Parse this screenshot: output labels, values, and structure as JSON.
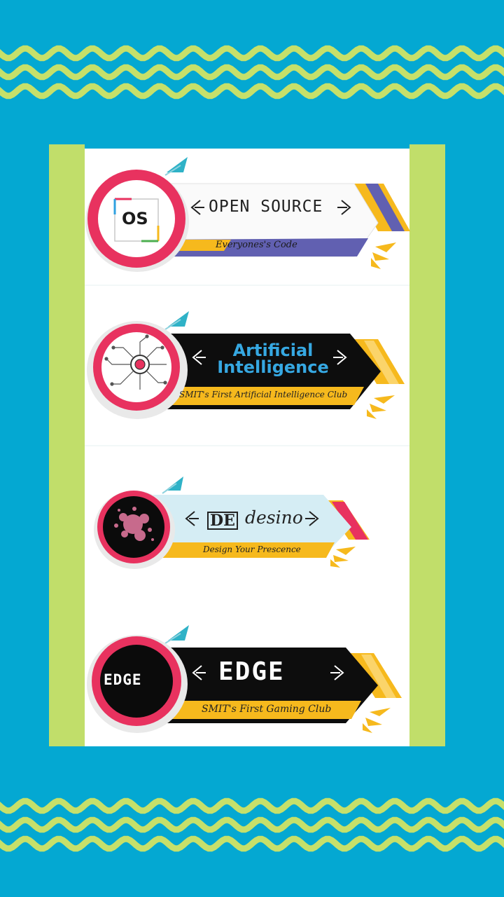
{
  "colors": {
    "background": "#04a8d2",
    "wave": "#c6e06a",
    "panel_side": "#c1de6a",
    "panel_body": "#ffffff",
    "ring": "#e8325f",
    "yellow": "#f6b91d",
    "violet": "#6160b1",
    "black": "#0d0d0d",
    "teal_flag": "#2fb2c7",
    "ai_blue": "#36a8e2",
    "pale_blue": "#d5edf4"
  },
  "clubs": [
    {
      "id": "open-source",
      "logo_text": "OS",
      "title": "OPEN SOURCE",
      "tagline": "Everyones's Code"
    },
    {
      "id": "artificial-intelligence",
      "logo_icon": "circuit-chip-icon",
      "title_line1": "Artificial",
      "title_line2": "Intelligence",
      "tagline": "SMIT's First Artificial Intelligence Club"
    },
    {
      "id": "desino",
      "logo_icon": "ink-splash-icon",
      "title_mark": "DE",
      "title_word": "desino",
      "tagline": "Design Your Prescence"
    },
    {
      "id": "edge",
      "logo_text": "EDGE",
      "title": "EDGE",
      "tagline": "SMIT's First Gaming Club"
    }
  ]
}
